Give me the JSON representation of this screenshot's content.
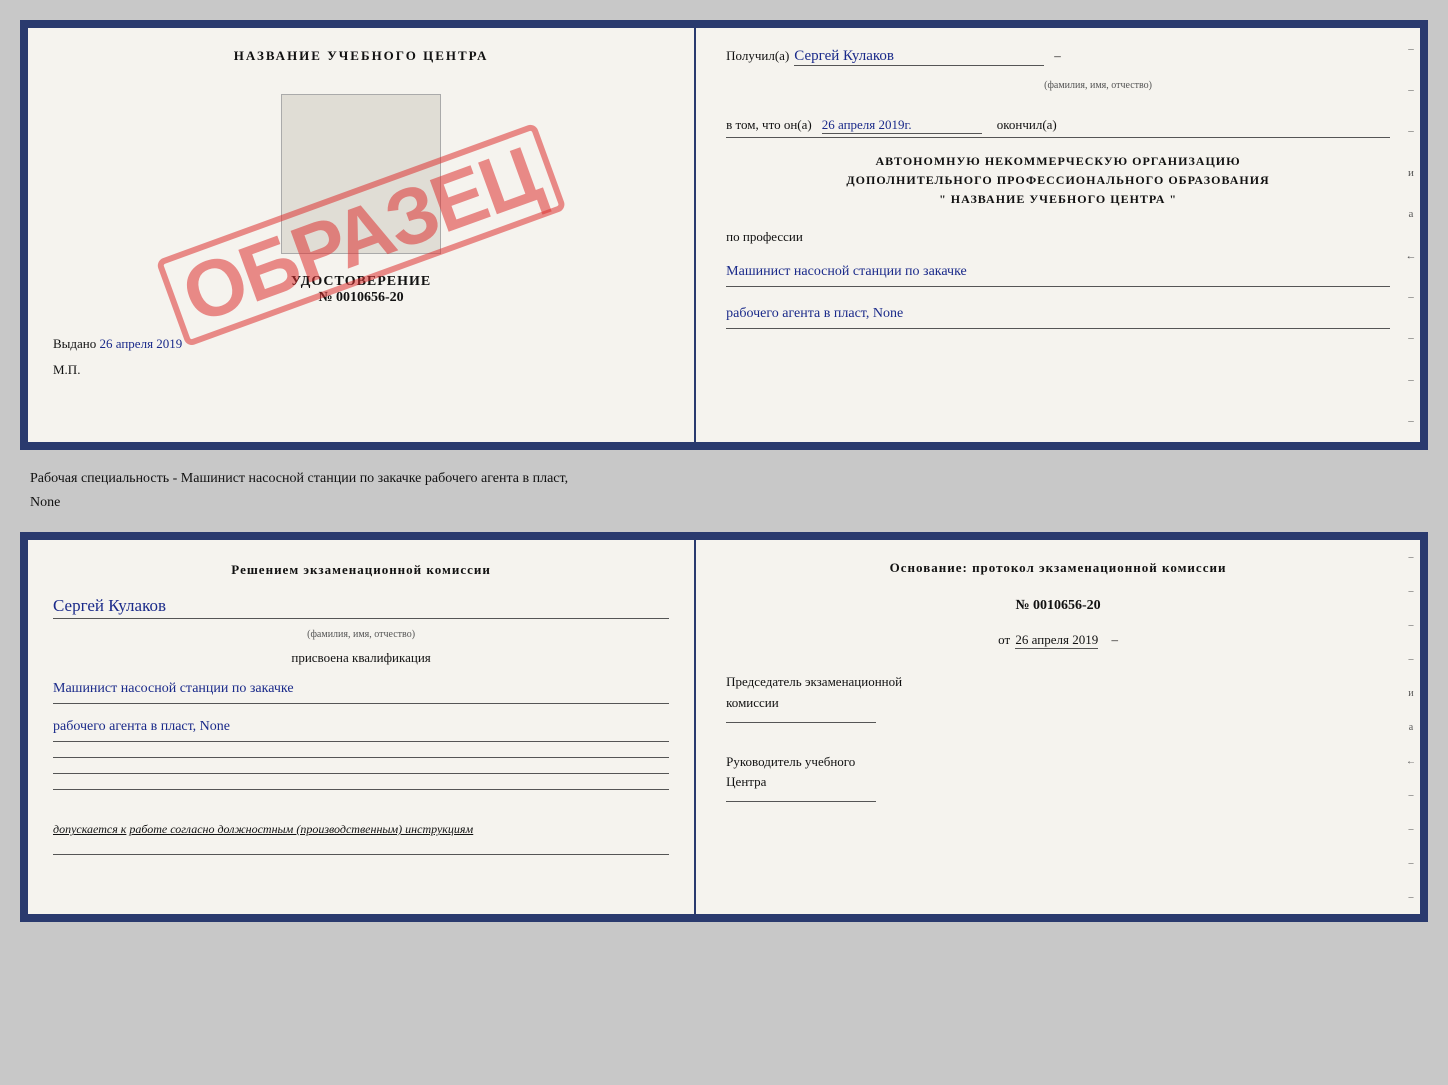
{
  "top_cert": {
    "left": {
      "title": "НАЗВАНИЕ УЧЕБНОГО ЦЕНТРА",
      "obrazets": "ОБРA\nЗЕЦ",
      "udost": "УДОСТОВЕРЕНИЕ",
      "number": "№ 0010656-20",
      "vydano_label": "Выдано",
      "vydano_date": "26 апреля 2019",
      "mp": "М.П."
    },
    "right": {
      "poluchil_label": "Получил(а)",
      "poluchil_name": "Сергей Кулаков",
      "fio_hint": "(фамилия, имя, отчество)",
      "vtom_label": "в том, что он(а)",
      "vtom_date": "26 апреля 2019г.",
      "okonchil_label": "окончил(а)",
      "org_line1": "АВТОНОМНУЮ НЕКОММЕРЧЕСКУЮ ОРГАНИЗАЦИЮ",
      "org_line2": "ДОПОЛНИТЕЛЬНОГО ПРОФЕССИОНАЛЬНОГО ОБРАЗОВАНИЯ",
      "org_line3": "\"  НАЗВАНИЕ УЧЕБНОГО ЦЕНТРА  \"",
      "po_professii": "по профессии",
      "profession1": "Машинист насосной станции по закачке",
      "profession2": "рабочего агента в пласт, None"
    }
  },
  "middle": {
    "text": "Рабочая специальность - Машинист насосной станции по закачке рабочего агента в пласт,",
    "text2": "None"
  },
  "bottom_cert": {
    "left": {
      "komissia": "Решением экзаменационной комиссии",
      "name": "Сергей Кулаков",
      "fio_hint": "(фамилия, имя, отчество)",
      "prisvoena": "присвоена квалификация",
      "profession1": "Машинист насосной станции по закачке",
      "profession2": "рабочего агента в пласт, None",
      "dopuskaetsya_label": "допускается к",
      "dopuskaetsya_text": "работе согласно должностным (производственным) инструкциям"
    },
    "right": {
      "osnovanie": "Основание: протокол экзаменационной комиссии",
      "proto_num": "№ 0010656-20",
      "proto_ot": "от",
      "proto_date": "26 апреля 2019",
      "predsedatel_line1": "Председатель экзаменационной",
      "predsedatel_line2": "комиссии",
      "rukovoditel_line1": "Руководитель учебного",
      "rukovoditel_line2": "Центра"
    }
  },
  "vert_dashes": [
    "–",
    "–",
    "–",
    "и",
    "а",
    "←",
    "–",
    "–",
    "–",
    "–"
  ],
  "vert_dashes2": [
    "–",
    "–",
    "–",
    "–",
    "и",
    "а",
    "←",
    "–",
    "–",
    "–",
    "–"
  ]
}
